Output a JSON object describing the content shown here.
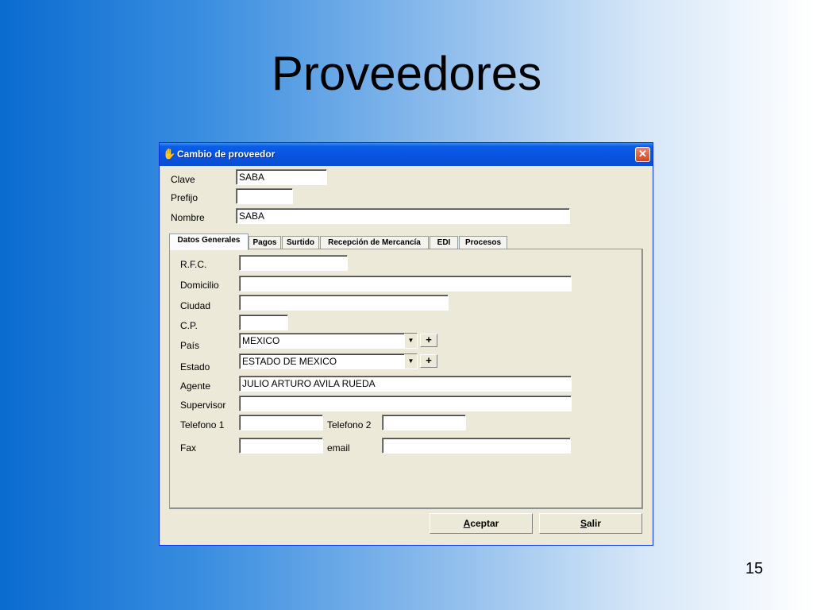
{
  "slide": {
    "title": "Proveedores",
    "page_number": "15"
  },
  "window": {
    "title": "Cambio de proveedor",
    "close_symbol": "✕"
  },
  "header_fields": {
    "clave": {
      "label": "Clave",
      "value": "SABA"
    },
    "prefijo": {
      "label": "Prefijo",
      "value": ""
    },
    "nombre": {
      "label": "Nombre",
      "value": "SABA"
    }
  },
  "tabs": [
    {
      "label": "Datos Generales",
      "active": true
    },
    {
      "label": "Pagos"
    },
    {
      "label": "Surtido"
    },
    {
      "label": "Recepción de Mercancía"
    },
    {
      "label": "EDI"
    },
    {
      "label": "Procesos"
    }
  ],
  "form": {
    "rfc": {
      "label": "R.F.C.",
      "value": ""
    },
    "domicilio": {
      "label": "Domicilio",
      "value": ""
    },
    "ciudad": {
      "label": "Ciudad",
      "value": ""
    },
    "cp": {
      "label": "C.P.",
      "value": ""
    },
    "pais": {
      "label": "País",
      "value": "MEXICO"
    },
    "estado": {
      "label": "Estado",
      "value": "ESTADO DE MEXICO"
    },
    "agente": {
      "label": "Agente",
      "value": "JULIO ARTURO AVILA RUEDA"
    },
    "supervisor": {
      "label": "Supervisor",
      "value": ""
    },
    "telefono1": {
      "label": "Telefono 1",
      "value": ""
    },
    "telefono2": {
      "label": "Telefono 2",
      "value": ""
    },
    "fax": {
      "label": "Fax",
      "value": ""
    },
    "email": {
      "label": "email",
      "value": ""
    }
  },
  "buttons": {
    "aceptar": {
      "label_first": "A",
      "label_rest": "ceptar"
    },
    "salir": {
      "label_first": "S",
      "label_rest": "alir"
    }
  },
  "icons": {
    "window_icon": "handshake-icon",
    "dropdown": "▼",
    "plus": "+"
  }
}
